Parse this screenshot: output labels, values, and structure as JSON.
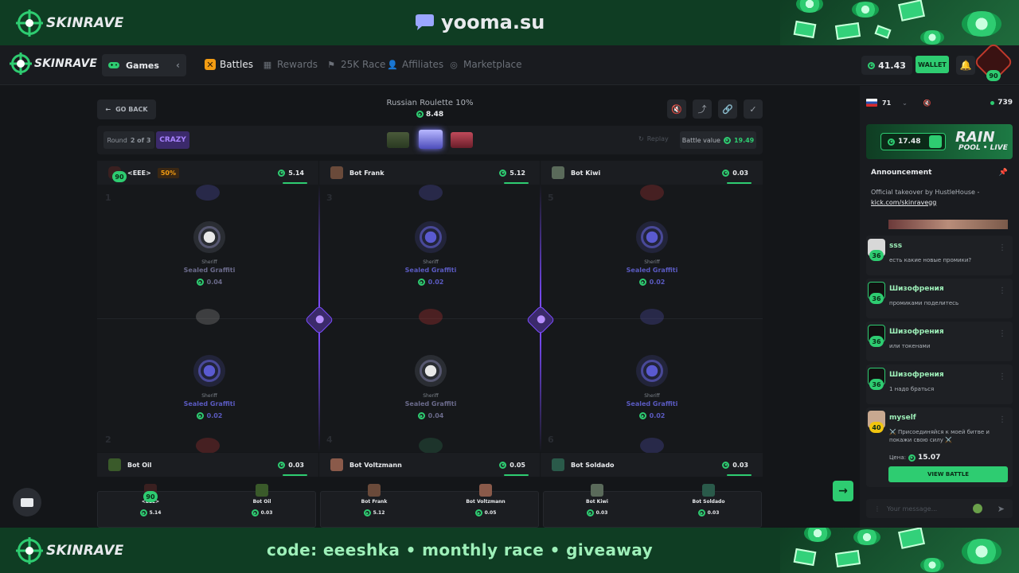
{
  "promo": {
    "brand": "SKINRAVE",
    "site": "yooma.su",
    "code_line": "code: eeeshka  •  monthly race  •  giveaway"
  },
  "nav": {
    "brand": "SKINRAVE",
    "games": "Games",
    "items": [
      "Battles",
      "Rewards",
      "25K Race",
      "Affiliates",
      "Marketplace"
    ],
    "balance": "41.43",
    "wallet": "WALLET",
    "user_level": "90"
  },
  "battle": {
    "go_back": "GO BACK",
    "mode": "Russian Roulette 10%",
    "price": "8.48",
    "round_label": "Round",
    "round_value": "2 of 3",
    "crazy": "CRAZY",
    "replay": "Replay",
    "battle_value_label": "Battle value",
    "battle_value": "19.49",
    "top_players": [
      {
        "name": "<EEE>",
        "pct": "50%",
        "value": "5.14",
        "level": "90"
      },
      {
        "name": "Bot Frank",
        "value": "5.12"
      },
      {
        "name": "Bot Kiwi",
        "value": "0.03"
      }
    ],
    "bottom_players": [
      {
        "name": "Bot Oil",
        "value": "0.03"
      },
      {
        "name": "Bot Voltzmann",
        "value": "0.05"
      },
      {
        "name": "Bot Soldado",
        "value": "0.03"
      }
    ],
    "slots": [
      {
        "num": "1",
        "kind": "Sheriff",
        "name": "Sealed Graffiti",
        "value": "0.04"
      },
      {
        "num": "3",
        "kind": "Sheriff",
        "name": "Sealed Graffiti",
        "value": "0.02"
      },
      {
        "num": "5",
        "kind": "Sheriff",
        "name": "Sealed Graffiti",
        "value": "0.02"
      },
      {
        "num": "2",
        "kind": "Sheriff",
        "name": "Sealed Graffiti",
        "value": "0.02"
      },
      {
        "num": "4",
        "kind": "Sheriff",
        "name": "Sealed Graffiti",
        "value": "0.04"
      },
      {
        "num": "6",
        "kind": "Sheriff",
        "name": "Sealed Graffiti",
        "value": "0.02"
      }
    ],
    "summary": [
      {
        "name": "<EEE>",
        "value": "5.14",
        "level": "90"
      },
      {
        "name": "Bot Oil",
        "value": "0.03"
      },
      {
        "name": "Bot Frank",
        "value": "5.12"
      },
      {
        "name": "Bot Voltzmann",
        "value": "0.05"
      },
      {
        "name": "Bot Kiwi",
        "value": "0.03"
      },
      {
        "name": "Bot Soldado",
        "value": "0.03"
      }
    ],
    "next": "→"
  },
  "sidebar": {
    "language_count": "71",
    "online": "739",
    "rain_amount": "17.48",
    "rain_title": "RAIN",
    "rain_sub": "POOL • LIVE",
    "announcement_title": "Announcement",
    "announcement_text": "Official takeover by HustleHouse -",
    "announcement_link": "kick.com/skinravegg",
    "messages": [
      {
        "user": "sss",
        "level": "36",
        "text": "есть какие новые промики?"
      },
      {
        "user": "Шизофрения",
        "level": "36",
        "text": "промиками поделитесь"
      },
      {
        "user": "Шизофрения",
        "level": "36",
        "text": "или токенами"
      },
      {
        "user": "Шизофрения",
        "level": "36",
        "text": "1 надо браться"
      }
    ],
    "battle_msg": {
      "user": "myself",
      "level": "40",
      "text": "⚔️ Присоединяйся к моей битве и покажи свою силу ⚔️",
      "price_label": "Цена:",
      "price": "15.07",
      "button": "VIEW BATTLE"
    },
    "input_placeholder": "Your message..."
  },
  "colors": {
    "accent": "#2ecc71",
    "purple": "#7b4bff",
    "orange": "#f39c12"
  }
}
